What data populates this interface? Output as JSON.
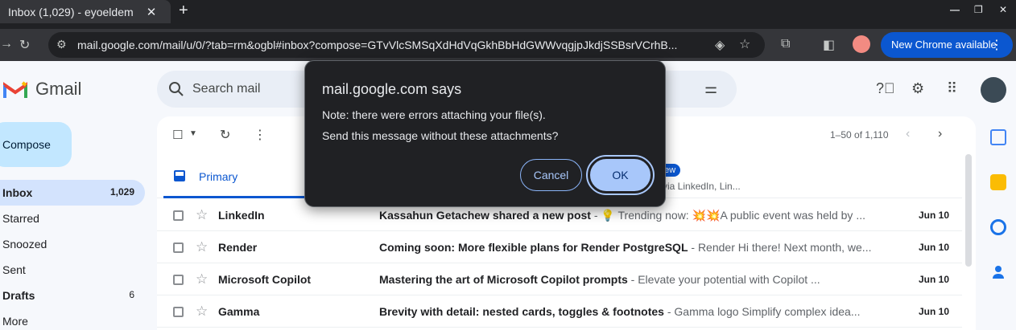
{
  "browser": {
    "tab_title": "Inbox (1,029) - eyoeldem",
    "tab_close": "✕",
    "new_tab": "+",
    "url": "mail.google.com/mail/u/0/?tab=rm&ogbl#inbox?compose=GTvVlcSMSqXdHdVqGkhBbHdGWWvqgjpJkdjSSBsrVCrhB...",
    "update_label": "New Chrome available"
  },
  "gmail": {
    "logo_text": "Gmail",
    "search_placeholder": "Search mail",
    "compose_label": "Compose",
    "nav": [
      {
        "label": "Inbox",
        "count": "1,029"
      },
      {
        "label": "Starred",
        "count": ""
      },
      {
        "label": "Snoozed",
        "count": ""
      },
      {
        "label": "Sent",
        "count": ""
      },
      {
        "label": "Drafts",
        "count": "6"
      },
      {
        "label": "More",
        "count": ""
      }
    ],
    "pager": "1–50 of 1,110",
    "tab_primary": "Primary",
    "promo_badge": "new",
    "promo_snippet": "e via LinkedIn, Lin...",
    "emails": [
      {
        "sender": "LinkedIn",
        "subject": "Kassahun Getachew shared a new post",
        "snippet": " - 💡 Trending now: 💥💥A public event was held by ...",
        "date": "Jun 10"
      },
      {
        "sender": "Render",
        "subject": "Coming soon: More flexible plans for Render PostgreSQL",
        "snippet": " - Render Hi there! Next month, we...",
        "date": "Jun 10"
      },
      {
        "sender": "Microsoft Copilot",
        "subject": "Mastering the art of Microsoft Copilot prompts",
        "snippet": " - Elevate your potential with Copilot ...",
        "date": "Jun 10"
      },
      {
        "sender": "Gamma",
        "subject": "Brevity with detail: nested cards, toggles & footnotes",
        "snippet": " - Gamma logo Simplify complex idea...",
        "date": "Jun 10"
      }
    ]
  },
  "dialog": {
    "title": "mail.google.com says",
    "message_line1": "Note: there were errors attaching your file(s).",
    "message_line2": "Send this message without these attachments?",
    "cancel_label": "Cancel",
    "ok_label": "OK"
  },
  "colors": {
    "accent": "#0b57d0",
    "dialog_bg": "#202124",
    "ok_button": "#a8c7fa"
  }
}
